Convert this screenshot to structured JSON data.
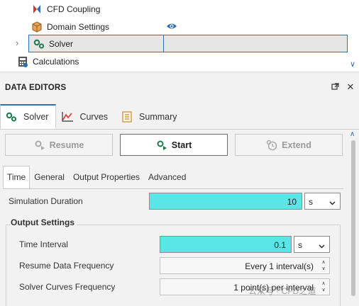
{
  "tree": {
    "items": [
      {
        "label": "CFD Coupling"
      },
      {
        "label": "Domain Settings"
      },
      {
        "label": "Solver"
      },
      {
        "label": "Calculations"
      }
    ]
  },
  "panel": {
    "title": "DATA EDITORS",
    "tabs": [
      {
        "label": "Solver",
        "active": true
      },
      {
        "label": "Curves",
        "active": false
      },
      {
        "label": "Summary",
        "active": false
      }
    ],
    "toolbar": {
      "resume_label": "Resume",
      "start_label": "Start",
      "extend_label": "Extend"
    },
    "subtabs": [
      {
        "label": "Time",
        "active": true
      },
      {
        "label": "General",
        "active": false
      },
      {
        "label": "Output Properties",
        "active": false
      },
      {
        "label": "Advanced",
        "active": false
      }
    ],
    "simulation_duration": {
      "label": "Simulation Duration",
      "value": "10",
      "unit": "s"
    },
    "output_settings": {
      "title": "Output Settings",
      "time_interval": {
        "label": "Time Interval",
        "value": "0.1",
        "unit": "s"
      },
      "resume_data_frequency": {
        "label": "Resume Data Frequency",
        "value": "Every 1 interval(s)"
      },
      "solver_curves_frequency": {
        "label": "Solver Curves Frequency",
        "value": "1 point(s) per interval"
      }
    }
  },
  "watermark": "公众号 · CFD之道",
  "colors": {
    "accent": "#2f6fb6",
    "input_highlight": "#5ae6e6"
  }
}
